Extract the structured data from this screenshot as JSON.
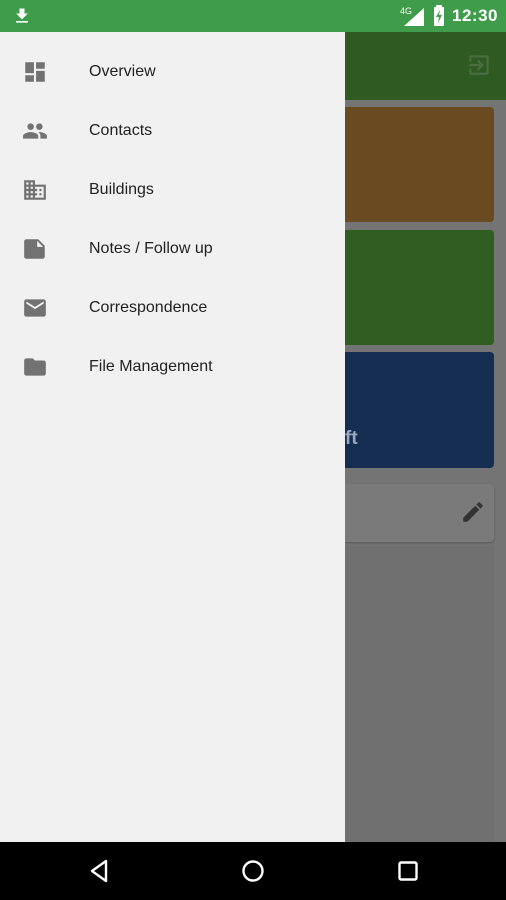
{
  "status_bar": {
    "time": "12:30",
    "network": "4G"
  },
  "drawer": {
    "items": [
      {
        "label": "Overview",
        "icon": "dashboard-icon"
      },
      {
        "label": "Contacts",
        "icon": "people-icon"
      },
      {
        "label": "Buildings",
        "icon": "building-icon"
      },
      {
        "label": "Notes / Follow up",
        "icon": "note-icon"
      },
      {
        "label": "Correspondence",
        "icon": "mail-icon"
      },
      {
        "label": "File Management",
        "icon": "folder-icon"
      }
    ]
  },
  "background": {
    "card3_partial_text": "ft"
  },
  "colors": {
    "status_bar": "#3f9c4a",
    "drawer": "#f1f1f1",
    "card_orange": "#6a4a21",
    "card_green": "#2f5d22",
    "card_blue": "#162d52"
  }
}
